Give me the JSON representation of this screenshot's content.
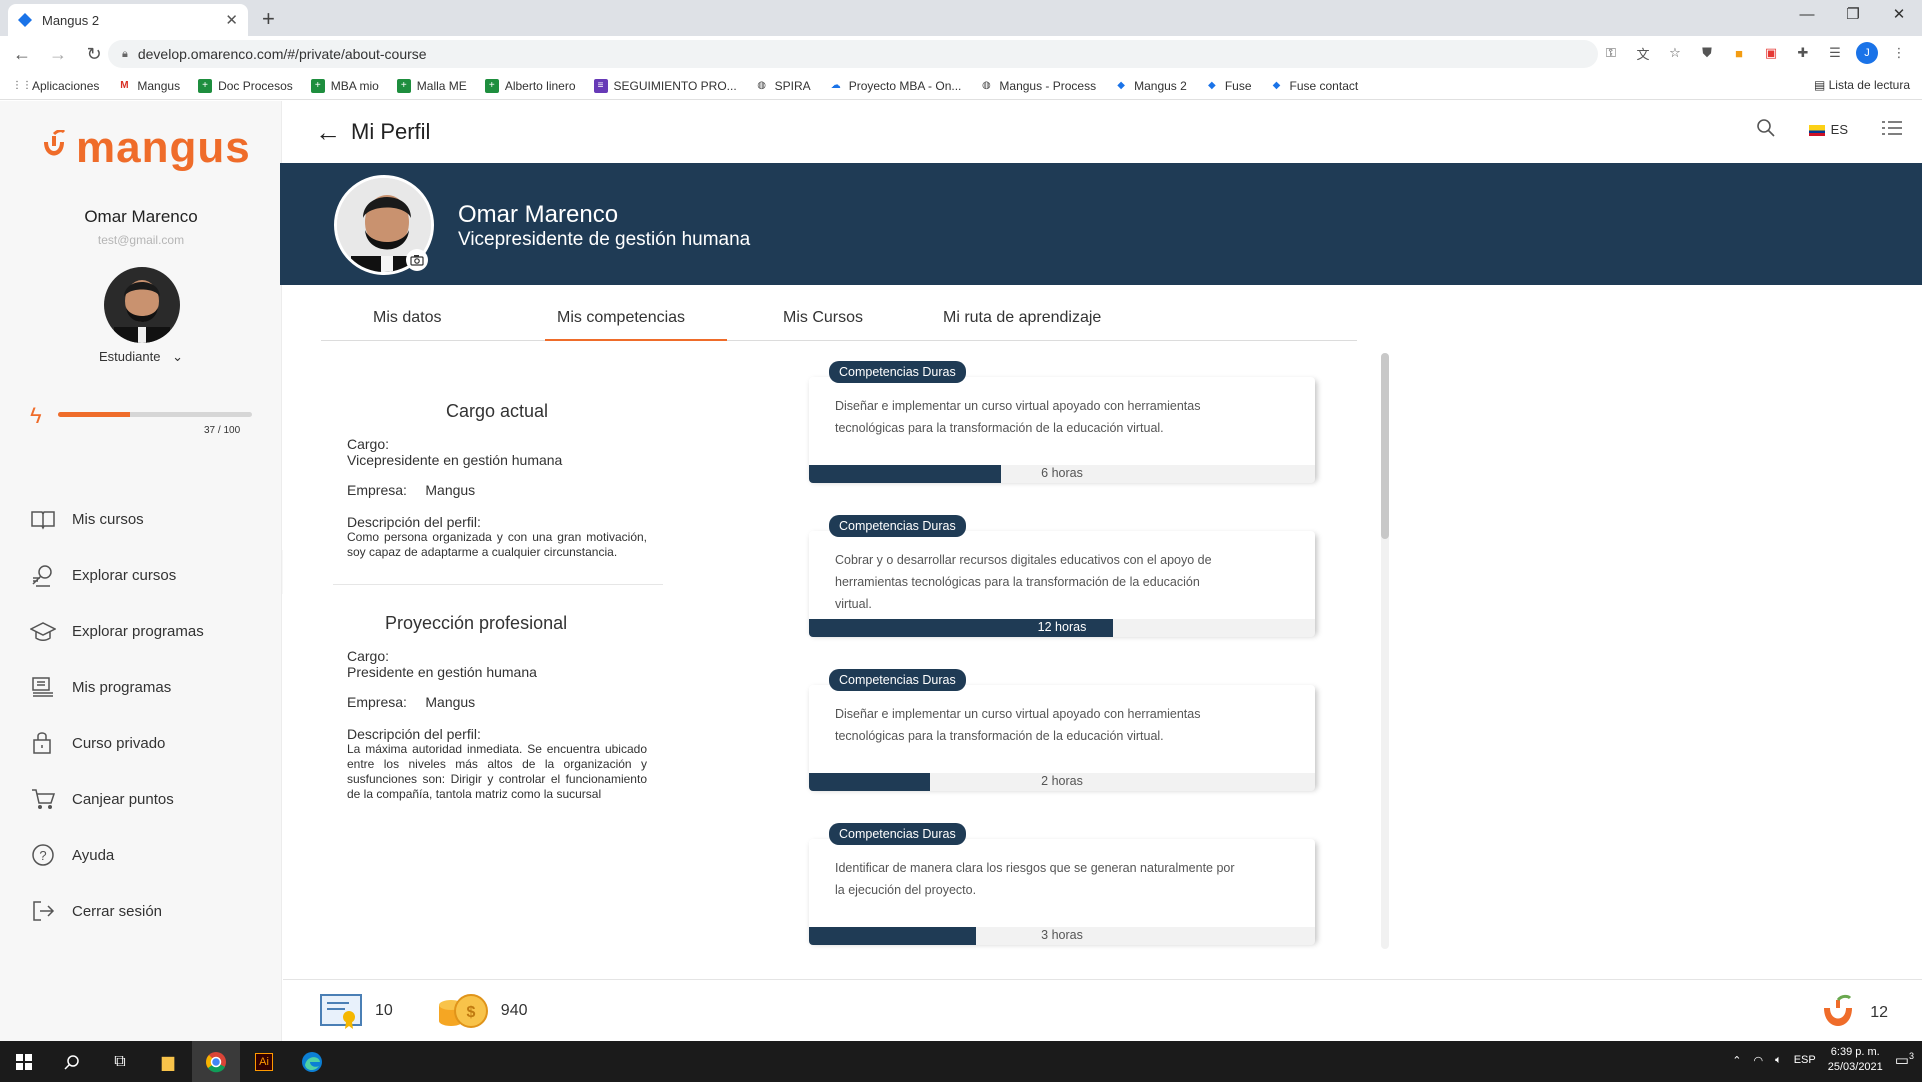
{
  "browser": {
    "tab_title": "Mangus 2",
    "url": "develop.omarenco.com/#/private/about-course",
    "bookmarks": [
      "Aplicaciones",
      "Mangus",
      "Doc Procesos",
      "MBA mio",
      "Malla ME",
      "Alberto linero",
      "SEGUIMIENTO PRO...",
      "SPIRA",
      "Proyecto MBA - On...",
      "Mangus - Process",
      "Mangus 2",
      "Fuse",
      "Fuse contact"
    ],
    "reading_list": "Lista de lectura",
    "profile_initial": "J"
  },
  "sidebar": {
    "logo": "mangus",
    "user_name": "Omar Marenco",
    "user_email": "test@gmail.com",
    "role": "Estudiante",
    "points_text": "37 / 100",
    "points_progress": 0.37,
    "menu": [
      {
        "label": "Mis cursos",
        "icon": "book-icon"
      },
      {
        "label": "Explorar cursos",
        "icon": "explore-courses-icon"
      },
      {
        "label": "Explorar programas",
        "icon": "graduation-cap-icon"
      },
      {
        "label": "Mis programas",
        "icon": "programs-icon"
      },
      {
        "label": "Curso privado",
        "icon": "private-course-icon"
      },
      {
        "label": "Canjear puntos",
        "icon": "cart-icon"
      },
      {
        "label": "Ayuda",
        "icon": "help-icon"
      },
      {
        "label": "Cerrar sesión",
        "icon": "logout-icon"
      }
    ]
  },
  "header": {
    "title": "Mi Perfil",
    "language": "ES"
  },
  "banner": {
    "name": "Omar Marenco",
    "role": "Vicepresidente de gestión humana"
  },
  "tabs": [
    "Mis datos",
    "Mis competencias",
    "Mis Cursos",
    "Mi ruta de aprendizaje"
  ],
  "current_position": {
    "title": "Cargo actual",
    "cargo_label": "Cargo:",
    "cargo_value": "Vicepresidente en gestión humana",
    "empresa_label": "Empresa:",
    "empresa_value": "Mangus",
    "desc_label": "Descripción del perfil:",
    "desc_value": "Como persona organizada y con una gran motivación, soy capaz de adaptarme a cualquier circunstancia."
  },
  "projection": {
    "title": "Proyección profesional",
    "cargo_label": "Cargo:",
    "cargo_value": "Presidente en gestión humana",
    "empresa_label": "Empresa:",
    "empresa_value": "Mangus",
    "desc_label": "Descripción del perfil:",
    "desc_value": "La máxima autoridad inmediata. Se encuentra ubicado entre los niveles más altos de la organización y susfunciones son: Dirigir y controlar el funcionamiento de la compañía, tantola matriz como la sucursal"
  },
  "competencies": [
    {
      "tag": "Competencias  Duras",
      "text": "Diseñar e implementar un curso virtual apoyado con herramientas tecnológicas para la transformación de la educación virtual.",
      "hours": "6 horas",
      "progress": 0.38
    },
    {
      "tag": "Competencias  Duras",
      "text": "Cobrar y o desarrollar recursos digitales educativos con el apoyo de herramientas tecnológicas para la transformación de la educación virtual.",
      "hours": "12 horas",
      "progress": 0.6
    },
    {
      "tag": "Competencias  Duras",
      "text": "Diseñar e implementar un curso virtual apoyado con herramientas tecnológicas para la transformación de la educación virtual.",
      "hours": "2 horas",
      "progress": 0.24
    },
    {
      "tag": "Competencias  Duras",
      "text": "Identificar de manera clara los riesgos que se generan naturalmente por la ejecución del proyecto.",
      "hours": "3 horas",
      "progress": 0.33
    }
  ],
  "footer": {
    "certificates": "10",
    "coins": "940",
    "mangus_count": "12"
  },
  "taskbar": {
    "lang": "ESP",
    "time": "6:39 p. m.",
    "date": "25/03/2021",
    "notifications": "3"
  },
  "colors": {
    "accent": "#ef6c2a",
    "navy": "#1f3b55"
  }
}
